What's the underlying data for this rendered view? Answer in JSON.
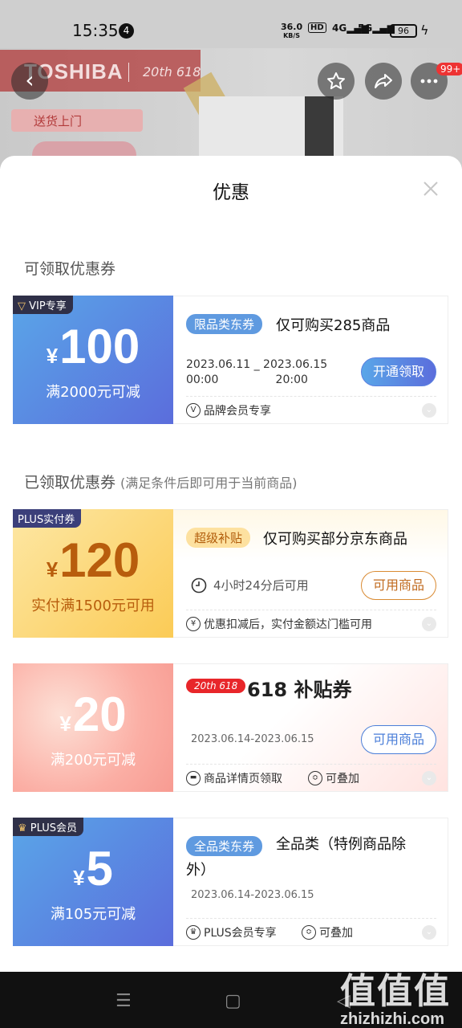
{
  "status_bar": {
    "time": "15:35",
    "notification_count": "4",
    "net_speed": "36.0",
    "net_unit": "KB/S",
    "hd": "HD",
    "sig1": "4G",
    "sig2": "5G",
    "battery": "96"
  },
  "background": {
    "brand": "TOSHIBA",
    "promo": "20th 618",
    "delivery": "送货上门",
    "badge_count": "99+"
  },
  "sheet": {
    "title": "优惠"
  },
  "sections": {
    "available_title": "可领取优惠券",
    "claimed_title": "已领取优惠券",
    "claimed_note": "(满足条件后即可用于当前商品)"
  },
  "coupons": [
    {
      "badge": "VIP专享",
      "yen": "¥",
      "amount": "100",
      "condition": "满2000元可减",
      "tag": "限品类东券",
      "title": "仅可购买285商品",
      "date_line1": "2023.06.11 _ 2023.06.15",
      "date_line2": "00:00                20:00",
      "cta": "开通领取",
      "footer": "品牌会员专享",
      "footer_icon": "V"
    },
    {
      "badge": "PLUS实付券",
      "yen": "¥",
      "amount": "120",
      "condition": "实付满1500元可用",
      "tag": "超级补贴",
      "title": "仅可购买部分京东商品",
      "countdown": "4小时24分后可用",
      "cta": "可用商品",
      "footer": "优惠扣减后，实付金额达门槛可用",
      "footer_icon": "¥"
    },
    {
      "yen": "¥",
      "amount": "20",
      "condition": "满200元可减",
      "logo": "20th 618",
      "title": "618 补贴券",
      "dates": "2023.06.14-2023.06.15",
      "cta": "可用商品",
      "footer": "商品详情页领取",
      "footer2": "可叠加"
    },
    {
      "badge": "PLUS会员",
      "yen": "¥",
      "amount": "5",
      "condition": "满105元可减",
      "tag": "全品类东券",
      "title_line1": "全品类（特例商品除",
      "title_line2": "外）",
      "dates": "2023.06.14-2023.06.15",
      "footer": "PLUS会员专享",
      "footer2": "可叠加"
    }
  ],
  "nav": {
    "menu": "☰",
    "home": "▢",
    "back": "◁"
  },
  "watermark": {
    "text": "值值值",
    "url": "zhizhizhi.com"
  },
  "colors": {
    "blue_start": "#5aa6e8",
    "blue_end": "#5b6ddc",
    "gold": "#fcd46a",
    "pink": "#fbb0a8",
    "accent_orange": "#d98a32"
  }
}
